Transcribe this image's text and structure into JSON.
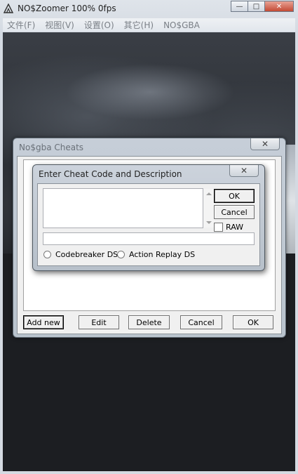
{
  "window": {
    "title": "NO$Zoomer 100% 0fps",
    "minimize": "—",
    "maximize": "□",
    "close": "✕"
  },
  "menu": [
    "文件(F)",
    "视图(V)",
    "设置(O)",
    "其它(H)",
    "NO$GBA"
  ],
  "cheats_dialog": {
    "title": "No$gba Cheats",
    "close": "✕",
    "buttons": {
      "add_new": "Add new",
      "edit": "Edit",
      "delete": "Delete",
      "cancel": "Cancel",
      "ok": "OK"
    }
  },
  "enter_dialog": {
    "title": "Enter Cheat Code and Description",
    "close": "✕",
    "code_value": "",
    "description_value": "",
    "ok": "OK",
    "cancel": "Cancel",
    "raw_label": "RAW",
    "raw_checked": false,
    "radio_codebreaker": "Codebreaker DS",
    "radio_action_replay": "Action Replay DS"
  },
  "colors": {
    "titlebar": "#dfe4ea",
    "close_button": "#c44a34",
    "game_background": "#1b1d21"
  }
}
